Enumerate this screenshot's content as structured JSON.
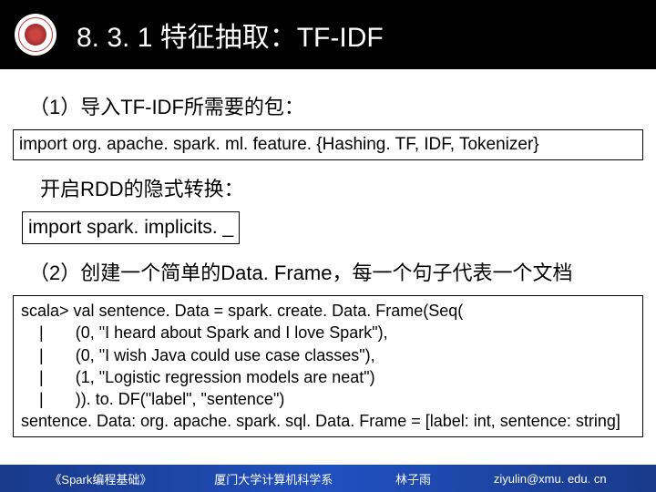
{
  "header": {
    "title": "8. 3. 1 特征抽取：TF-IDF"
  },
  "section1": {
    "label": "（1）导入TF-IDF所需要的包：",
    "code": "import org. apache. spark. ml. feature. {Hashing. TF, IDF, Tokenizer}"
  },
  "section1b": {
    "label": "开启RDD的隐式转换：",
    "code": "import spark. implicits. _"
  },
  "section2": {
    "label": "（2）创建一个简单的Data. Frame，每一个句子代表一个文档",
    "code": "scala> val sentence. Data = spark. create. Data. Frame(Seq(\n    |       (0, \"I heard about Spark and I love Spark\"),\n    |       (0, \"I wish Java could use case classes\"),\n    |       (1, \"Logistic regression models are neat\")\n    |       )). to. DF(\"label\", \"sentence\")\nsentence. Data: org. apache. spark. sql. Data. Frame = [label: int, sentence: string]"
  },
  "footer": {
    "book": "《Spark编程基础》",
    "dept": "厦门大学计算机科学系",
    "author": "林子雨",
    "email": "ziyulin@xmu. edu. cn"
  }
}
